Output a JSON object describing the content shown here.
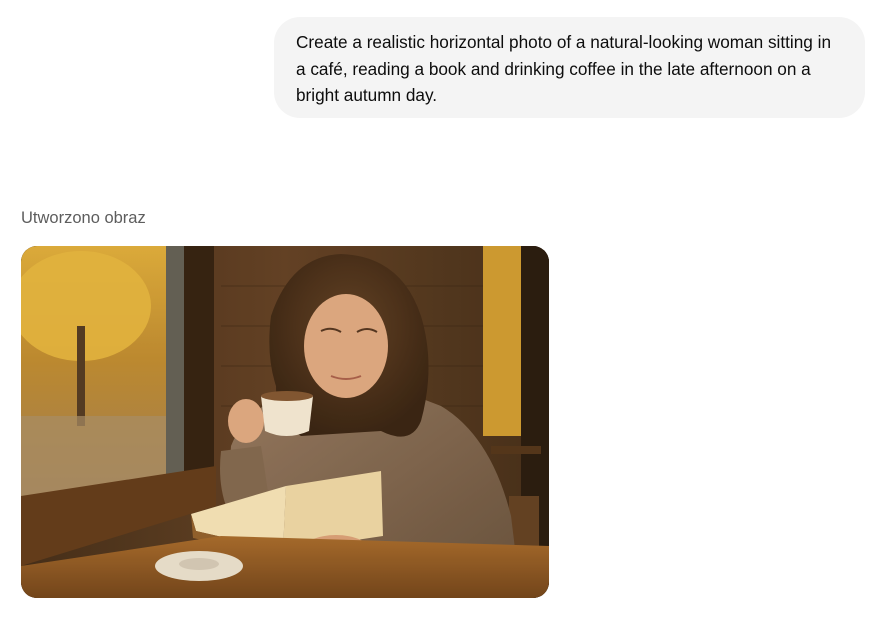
{
  "conversation": {
    "user_message": "Create a realistic horizontal photo of a natural-looking woman sitting in a café, reading a book and drinking coffee in the late afternoon on a bright autumn day.",
    "assistant": {
      "status_label": "Utworzono obraz",
      "image_description": "Woman with wavy brown hair in a knit sweater sipping coffee while reading an open book at a wooden café table by a window with autumn trees outside"
    }
  },
  "colors": {
    "bubble_bg": "#f4f4f4",
    "text": "#0d0d0d",
    "label": "#5d5d5d"
  }
}
